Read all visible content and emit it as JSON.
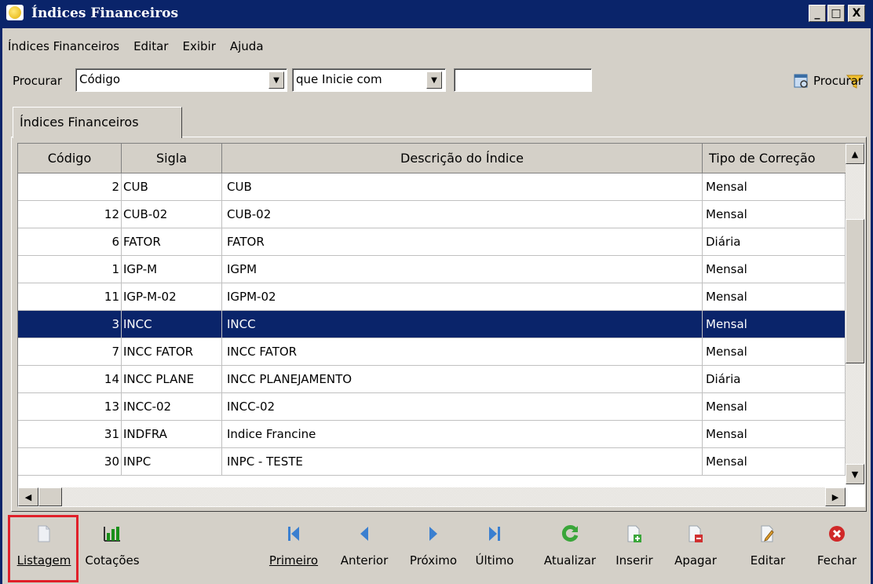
{
  "window": {
    "title": "Índices Financeiros",
    "controls": [
      "_",
      "□",
      "X"
    ]
  },
  "menu": [
    {
      "label": "Índices Financeiros",
      "accel": "Í"
    },
    {
      "label": "Editar",
      "accel": "E"
    },
    {
      "label": "Exibir",
      "accel": "x"
    },
    {
      "label": "Ajuda",
      "accel": "A"
    }
  ],
  "search": {
    "label": "Procurar",
    "field_value": "Código",
    "condition_value": "que Inicie com",
    "text_value": "",
    "button_label": "Procurar"
  },
  "tab": {
    "label": "Índices Financeiros"
  },
  "grid": {
    "columns": [
      "Código",
      "Sigla",
      "Descrição do Índice",
      "Tipo de Correção"
    ],
    "rows": [
      {
        "codigo": "2",
        "sigla": "CUB",
        "descricao": "CUB",
        "tipo": "Mensal"
      },
      {
        "codigo": "12",
        "sigla": "CUB-02",
        "descricao": "CUB-02",
        "tipo": "Mensal"
      },
      {
        "codigo": "6",
        "sigla": "FATOR",
        "descricao": "FATOR",
        "tipo": "Diária"
      },
      {
        "codigo": "1",
        "sigla": "IGP-M",
        "descricao": "IGPM",
        "tipo": "Mensal"
      },
      {
        "codigo": "11",
        "sigla": "IGP-M-02",
        "descricao": "IGPM-02",
        "tipo": "Mensal"
      },
      {
        "codigo": "3",
        "sigla": "INCC",
        "descricao": "INCC",
        "tipo": "Mensal"
      },
      {
        "codigo": "7",
        "sigla": "INCC FATOR",
        "descricao": "INCC FATOR",
        "tipo": "Mensal"
      },
      {
        "codigo": "14",
        "sigla": "INCC PLANE",
        "descricao": "INCC PLANEJAMENTO",
        "tipo": "Diária"
      },
      {
        "codigo": "13",
        "sigla": "INCC-02",
        "descricao": "INCC-02",
        "tipo": "Mensal"
      },
      {
        "codigo": "31",
        "sigla": "INDFRA",
        "descricao": "Indice Francine",
        "tipo": "Mensal"
      },
      {
        "codigo": "30",
        "sigla": "INPC",
        "descricao": "INPC - TESTE",
        "tipo": "Mensal"
      }
    ],
    "selected_index": 5
  },
  "toolbar": {
    "listagem": "Listagem",
    "cotacoes": "Cotações",
    "primeiro": "Primeiro",
    "anterior": "Anterior",
    "proximo": "Próximo",
    "ultimo": "Último",
    "atualizar": "Atualizar",
    "inserir": "Inserir",
    "apagar": "Apagar",
    "editar": "Editar",
    "fechar": "Fechar"
  },
  "colors": {
    "title_bar": "#0a246a",
    "selection": "#0a246a",
    "highlight_box": "#e0202a",
    "face": "#d4d0c8"
  }
}
